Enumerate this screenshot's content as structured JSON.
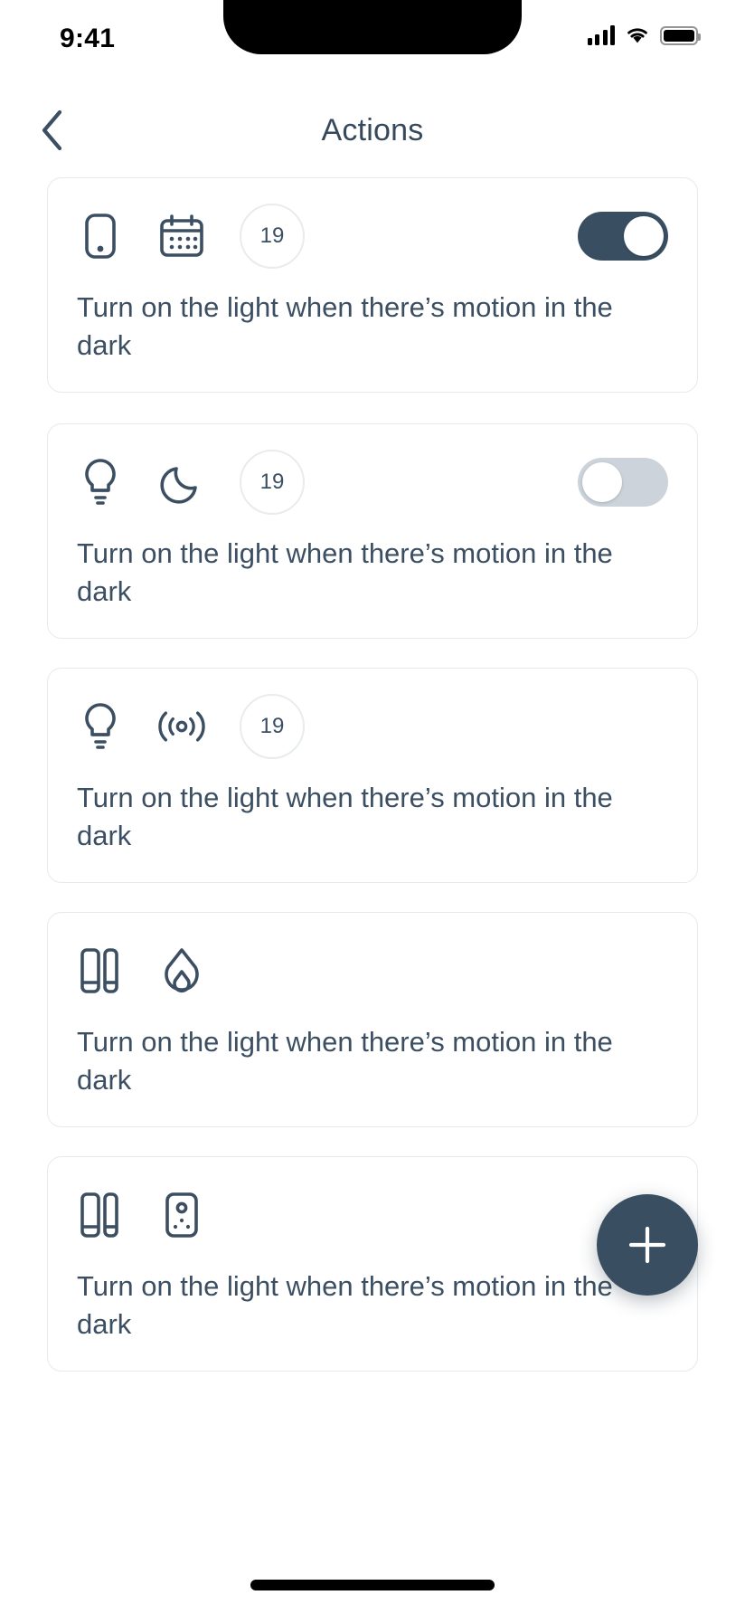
{
  "status_bar": {
    "time": "9:41",
    "signal_icon": "cellular-signal-icon",
    "wifi_icon": "wifi-icon",
    "battery_icon": "battery-full-icon"
  },
  "header": {
    "back_icon": "chevron-left-icon",
    "title": "Actions"
  },
  "theme": {
    "accent": "#3a4e62",
    "text": "#3c4f62",
    "card_border": "#e6eaee",
    "toggle_off": "#ccd3da"
  },
  "fab": {
    "icon": "plus-icon",
    "label": "+"
  },
  "cards": [
    {
      "icons": [
        "remote-control-icon",
        "calendar-icon"
      ],
      "badge": "19",
      "has_badge": true,
      "has_toggle": true,
      "toggle_state": "on",
      "text": "Turn on the light when there’s motion in the dark"
    },
    {
      "icons": [
        "lightbulb-icon",
        "moon-icon"
      ],
      "badge": "19",
      "has_badge": true,
      "has_toggle": true,
      "toggle_state": "off",
      "text": "Turn on the light when there’s motion in the dark"
    },
    {
      "icons": [
        "lightbulb-icon",
        "motion-sensor-icon"
      ],
      "badge": "19",
      "has_badge": true,
      "has_toggle": false,
      "toggle_state": "",
      "text": "Turn on the light when there’s motion in the dark"
    },
    {
      "icons": [
        "blinds-icon",
        "flame-icon"
      ],
      "badge": "",
      "has_badge": false,
      "has_toggle": false,
      "toggle_state": "",
      "text": "Turn on the light when there’s motion in the dark"
    },
    {
      "icons": [
        "blinds-icon",
        "sensor-device-icon"
      ],
      "badge": "",
      "has_badge": false,
      "has_toggle": false,
      "toggle_state": "",
      "text": "Turn on the light when there’s motion in the dark"
    }
  ]
}
